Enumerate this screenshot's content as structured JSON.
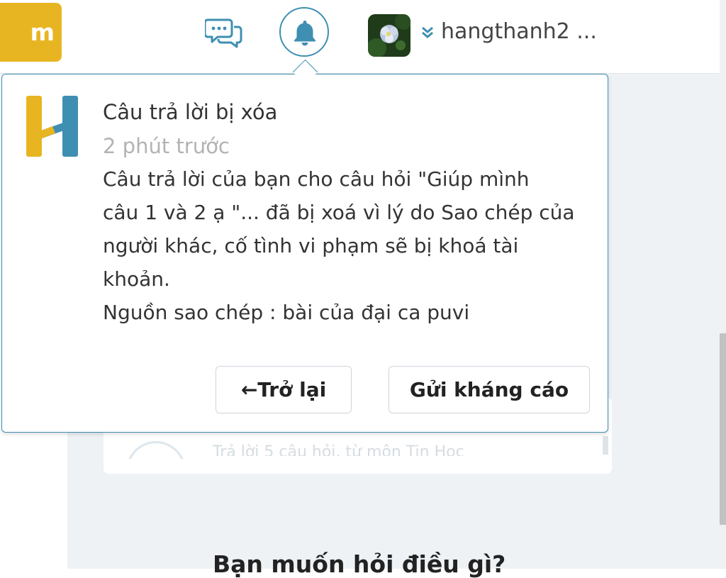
{
  "header": {
    "brand_button_label": "m",
    "chat_icon": "chat-bubbles-icon",
    "bell_icon": "bell-icon",
    "username": "hangthanh2 ...",
    "accent_color": "#3f8fb2",
    "brand_color": "#e8b522"
  },
  "notification": {
    "logo_icon": "hoc24-h-logo",
    "title": "Câu trả lời bị xóa",
    "time": "2 phút trước",
    "body_lines": [
      "Câu trả lời của bạn cho câu hỏi \"Giúp mình",
      "câu 1 và 2 ạ \"... đã bị xoá vì lý do Sao chép của",
      "người khác, cố tình vi phạm sẽ bị khoá tài",
      "khoản.",
      "Nguồn sao chép : bài của đại ca puvi"
    ],
    "back_button": "←Trở lại",
    "appeal_button": "Gửi kháng cáo"
  },
  "background": {
    "faded_text": "Trả lời 5 câu hỏi, từ môn Tin Học",
    "ask_heading": "Bạn muốn hỏi điều gì?"
  }
}
